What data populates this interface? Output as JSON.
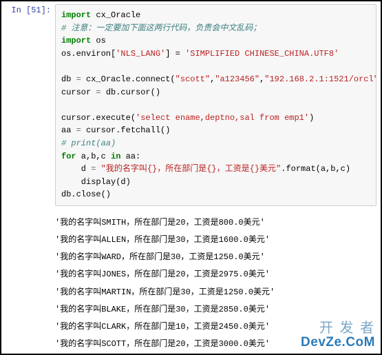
{
  "prompt": "In  [51]:",
  "code": {
    "l1_kw": "import",
    "l1_mod": "cx_Oracle",
    "l2_comment": "# 注意：一定要加下面这两行代码，负责会中文乱码；",
    "l3_kw": "import",
    "l3_mod": "os",
    "l4_prefix": "os.environ[",
    "l4_key": "'NLS_LANG'",
    "l4_eq": "] = ",
    "l4_val": "'SIMPLIFIED CHINESE_CHINA.UTF8'",
    "l6a": "db ",
    "l6op": "=",
    "l6b": " cx_Oracle.connect(",
    "l6s1": "\"scott\"",
    "l6c1": ",",
    "l6s2": "\"a123456\"",
    "l6c2": ",",
    "l6s3": "\"192.168.2.1:1521/orcl\"",
    "l6d": ")",
    "l7a": "cursor ",
    "l7op": "=",
    "l7b": " db.cursor()",
    "l9a": "cursor.execute(",
    "l9s": "'select ename,deptno,sal from emp1'",
    "l9b": ")",
    "l10a": "aa ",
    "l10op": "=",
    "l10b": " cursor.fetchall()",
    "l11_comment": "# print(aa)",
    "l12_for": "for",
    "l12_vars": " a,b,c ",
    "l12_in": "in",
    "l12_tail": " aa:",
    "l13a": "    d ",
    "l13op": "=",
    "l13b": " ",
    "l13s": "\"我的名字叫{}，所在部门是{}，工资是{}美元\"",
    "l13c": ".format(a,b,c)",
    "l14": "    display(d)",
    "l15": "db.close()"
  },
  "output": [
    "'我的名字叫SMITH，所在部门是20，工资是800.0美元'",
    "'我的名字叫ALLEN，所在部门是30，工资是1600.0美元'",
    "'我的名字叫WARD，所在部门是30，工资是1250.0美元'",
    "'我的名字叫JONES，所在部门是20，工资是2975.0美元'",
    "'我的名字叫MARTIN，所在部门是30，工资是1250.0美元'",
    "'我的名字叫BLAKE，所在部门是30，工资是2850.0美元'",
    "'我的名字叫CLARK，所在部门是10，工资是2450.0美元'",
    "'我的名字叫SCOTT，所在部门是20，工资是3000.0美元'"
  ],
  "watermark": {
    "line1": "开 发 者",
    "line2": "DevZe.CoM"
  }
}
